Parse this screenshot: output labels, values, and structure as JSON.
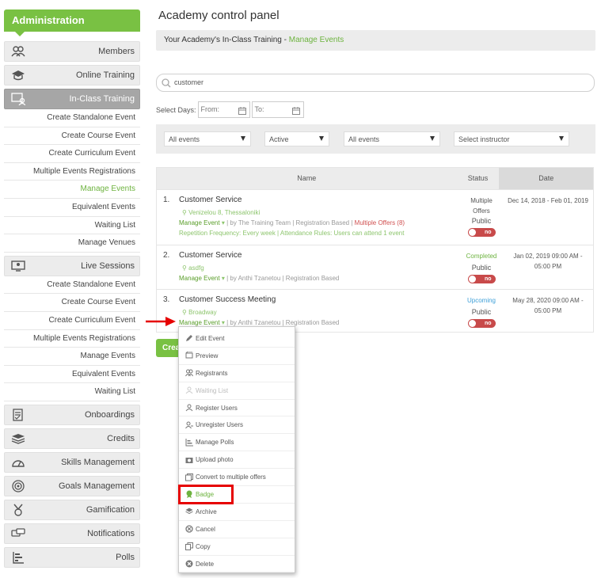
{
  "sidebar": {
    "header": "Administration",
    "items": [
      {
        "label": "Members",
        "icon": "members-icon"
      },
      {
        "label": "Online Training",
        "icon": "graduation-cap-icon"
      },
      {
        "label": "In-Class Training",
        "icon": "classroom-icon",
        "active": true
      },
      {
        "label": "Live Sessions",
        "icon": "monitor-icon"
      },
      {
        "label": "Onboardings",
        "icon": "checklist-icon"
      },
      {
        "label": "Credits",
        "icon": "layers-icon"
      },
      {
        "label": "Skills Management",
        "icon": "gauge-icon"
      },
      {
        "label": "Goals Management",
        "icon": "target-icon"
      },
      {
        "label": "Gamification",
        "icon": "medal-icon"
      },
      {
        "label": "Notifications",
        "icon": "chat-icon"
      },
      {
        "label": "Polls",
        "icon": "bar-chart-icon"
      }
    ],
    "inclass_sub": [
      "Create Standalone Event",
      "Create Course Event",
      "Create Curriculum Event",
      "Multiple Events Registrations",
      "Manage Events",
      "Equivalent Events",
      "Waiting List",
      "Manage Venues"
    ],
    "live_sub": [
      "Create Standalone Event",
      "Create Course Event",
      "Create Curriculum Event",
      "Multiple Events Registrations",
      "Manage Events",
      "Equivalent Events",
      "Waiting List"
    ]
  },
  "main": {
    "title": "Academy control panel",
    "crumb_prefix": "Your Academy's In-Class Training - ",
    "crumb_link": "Manage Events",
    "search_value": "customer",
    "select_days_label": "Select Days:",
    "from_placeholder": "From:",
    "to_placeholder": "To:",
    "filters": [
      "All events",
      "Active",
      "All events",
      "Select instructor"
    ],
    "table": {
      "headers": {
        "name": "Name",
        "status": "Status",
        "date": "Date"
      },
      "rows": [
        {
          "num": "1.",
          "name": "Customer Service",
          "location": "Venizelou 8, Thessaloniki",
          "manage": "Manage Event",
          "meta": " | by The Training Team | Registration Based | ",
          "meta_red": "Multiple Offers (8)",
          "repetition": "Repetition Frequency: Every week | Attendance Rules: Users can attend 1 event",
          "status1": "Multiple",
          "status2": "Offers",
          "visibility": "Public",
          "toggle": "no",
          "date": "Dec 14, 2018 - Feb 01, 2019"
        },
        {
          "num": "2.",
          "name": "Customer Service",
          "location": "asdfg",
          "manage": "Manage Event",
          "meta": " | by Anthi Tzanetou | Registration Based",
          "status1": "Completed",
          "visibility": "Public",
          "toggle": "no",
          "date1": "Jan 02, 2019 09:00 AM -",
          "date2": "05:00 PM"
        },
        {
          "num": "3.",
          "name": "Customer Success Meeting",
          "location": "Broadway",
          "manage": "Manage Event",
          "meta": " | by Anthi Tzanetou | Registration Based",
          "status1": "Upcoming",
          "visibility": "Public",
          "toggle": "no",
          "date1": "May 28, 2020 09:00 AM -",
          "date2": "05:00 PM"
        }
      ]
    },
    "create_button": "Create"
  },
  "dropdown": [
    {
      "label": "Edit Event",
      "icon": "pencil-icon"
    },
    {
      "label": "Preview",
      "icon": "preview-icon"
    },
    {
      "label": "Registrants",
      "icon": "users-icon"
    },
    {
      "label": "Waiting List",
      "icon": "waiting-list-icon",
      "disabled": true
    },
    {
      "label": "Register Users",
      "icon": "user-add-icon"
    },
    {
      "label": "Unregister Users",
      "icon": "user-remove-icon"
    },
    {
      "label": "Manage Polls",
      "icon": "poll-icon"
    },
    {
      "label": "Upload photo",
      "icon": "camera-icon"
    },
    {
      "label": "Convert to multiple offers",
      "icon": "convert-icon"
    },
    {
      "label": "Badge",
      "icon": "badge-icon",
      "highlight": true
    },
    {
      "label": "Archive",
      "icon": "archive-icon"
    },
    {
      "label": "Cancel",
      "icon": "cancel-icon"
    },
    {
      "label": "Copy",
      "icon": "copy-icon"
    },
    {
      "label": "Delete",
      "icon": "delete-icon"
    }
  ],
  "colors": {
    "accent": "#79c143",
    "link": "#6db33f",
    "danger": "#c84a4a",
    "upcoming": "#3fa0d8",
    "highlight": "#e60000"
  }
}
